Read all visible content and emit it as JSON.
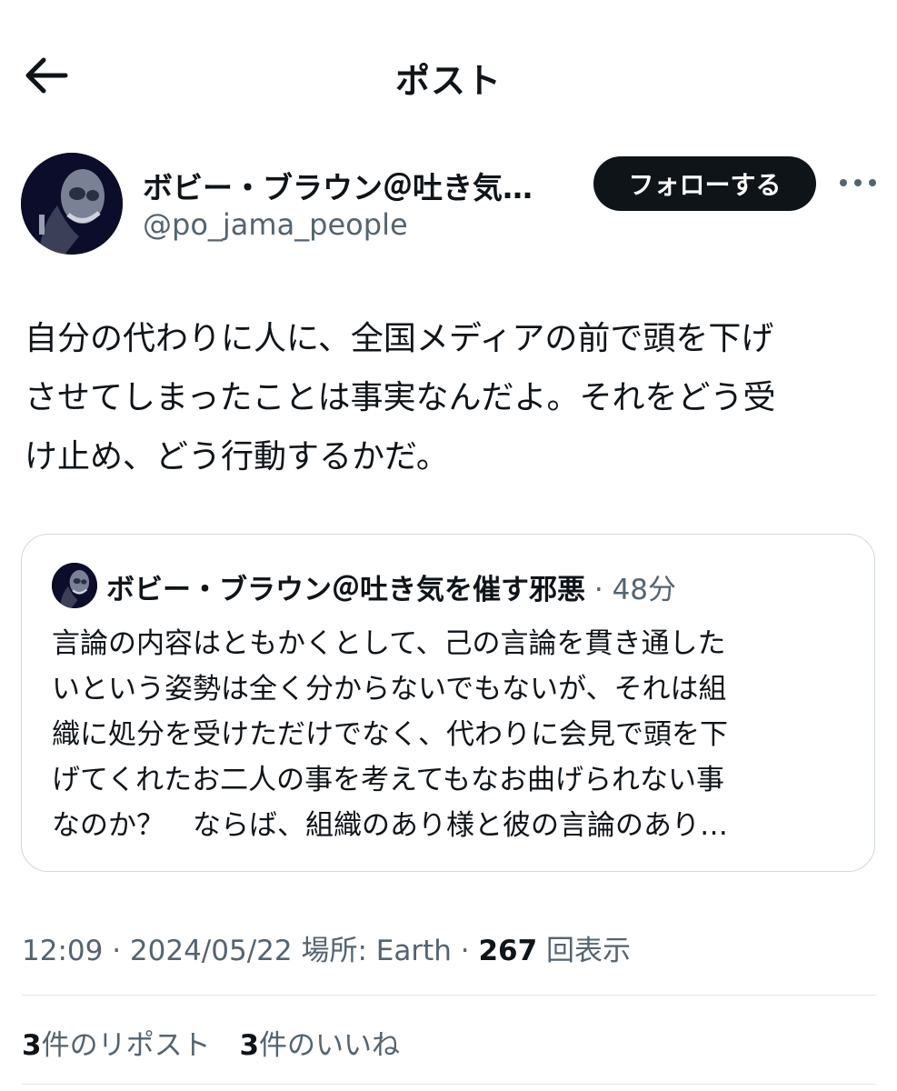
{
  "header": {
    "title": "ポスト"
  },
  "author": {
    "display_name": "ボビー・ブラウン＠吐き気…",
    "handle": "@po_jama_people"
  },
  "follow_button": {
    "label": "フォローする"
  },
  "tweet": {
    "text": "自分の代わりに人に、全国メディアの前で頭を下げ\nさせてしまったことは事実なんだよ。それをどう受\nけ止め、どう行動するかだ。"
  },
  "quote": {
    "display_name": "ボビー・ブラウン＠吐き気を催す邪悪",
    "separator": " · ",
    "time": "48分",
    "text": "言論の内容はともかくとして、己の言論を貫き通した\nいという姿勢は全く分からないでもないが、それは組\n織に処分を受けただけでなく、代わりに会見で頭を下\nげてくれたお二人の事を考えてもなお曲げられない事\nなのか？　ならば、組織のあり様と彼の言論のあり…"
  },
  "meta": {
    "time": "12:09",
    "date": "2024/05/22",
    "location_label": "場所: Earth",
    "separator": " · ",
    "views_count": "267",
    "views_label": "回表示"
  },
  "stats": {
    "reposts_count": "3",
    "reposts_label": "件のリポスト",
    "likes_count": "3",
    "likes_label": "件のいいね"
  },
  "icons": {
    "back": "arrow-left-icon",
    "more": "more-horizontal-icon"
  },
  "colors": {
    "text_primary": "#0f1419",
    "text_secondary": "#536471",
    "border": "#cfd9de",
    "follow_bg": "#0f1419"
  }
}
